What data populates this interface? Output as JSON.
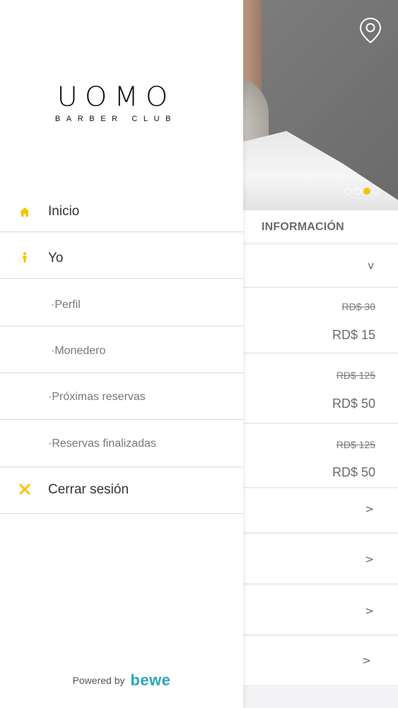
{
  "drawer": {
    "logo": {
      "word": "UOMO",
      "sub": "BARBER CLUB"
    },
    "items": [
      {
        "label": "Inicio",
        "icon": "home-icon"
      },
      {
        "label": "Yo",
        "icon": "person-icon"
      },
      {
        "label": "·Perfil"
      },
      {
        "label": "·Monedero"
      },
      {
        "label": "·Próximas reservas"
      },
      {
        "label": "·Reservas finalizadas"
      },
      {
        "label": "Cerrar sesión",
        "icon": "close-icon"
      }
    ],
    "powered_by": {
      "prefix": "Powered by",
      "brand": "bewe"
    }
  },
  "background": {
    "section_title": "INFORMACIÓN",
    "carousel": {
      "count": 4,
      "active_index": 2
    },
    "prices": [
      {
        "old": "RD$ 30",
        "new": "RD$ 15"
      },
      {
        "old": "RD$ 125",
        "new": "RD$ 50"
      },
      {
        "old": "RD$ 125",
        "new": "RD$ 50"
      }
    ],
    "chevrons": {
      "down": "v",
      "right": ">"
    }
  },
  "colors": {
    "accent": "#f2c500",
    "brand": "#2aa7b8"
  }
}
